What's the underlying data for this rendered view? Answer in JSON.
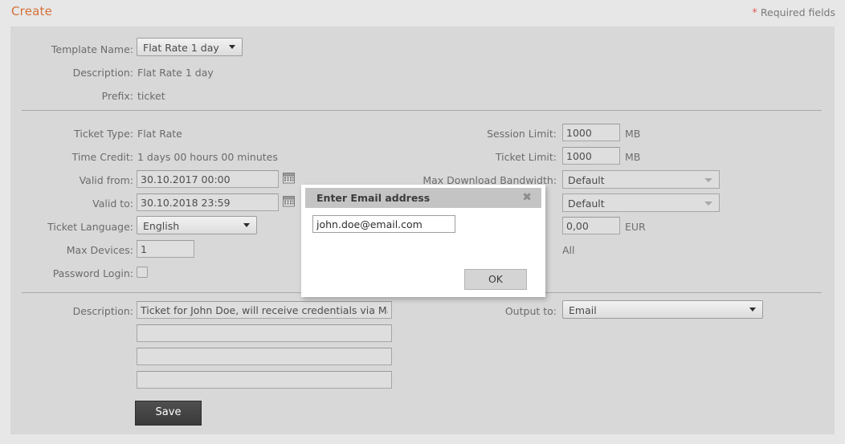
{
  "header": {
    "title": "Create",
    "required_star": "*",
    "required_label": "Required fields"
  },
  "template_section": {
    "template_name_label": "Template Name:",
    "template_name_value": "Flat Rate 1 day",
    "description_label": "Description:",
    "description_value": "Flat Rate 1 day",
    "prefix_label": "Prefix:",
    "prefix_value": "ticket"
  },
  "ticket_section": {
    "ticket_type_label": "Ticket Type:",
    "ticket_type_value": "Flat Rate",
    "time_credit_label": "Time Credit:",
    "time_credit_value": "1 days 00 hours 00 minutes",
    "valid_from_label": "Valid from:",
    "valid_from_value": "30.10.2017 00:00",
    "valid_to_label": "Valid to:",
    "valid_to_value": "30.10.2018 23:59",
    "ticket_language_label": "Ticket Language:",
    "ticket_language_value": "English",
    "max_devices_label": "Max Devices:",
    "max_devices_value": "1",
    "password_login_label": "Password Login:",
    "session_limit_label": "Session Limit:",
    "session_limit_value": "1000",
    "session_limit_unit": "MB",
    "ticket_limit_label": "Ticket Limit:",
    "ticket_limit_value": "1000",
    "ticket_limit_unit": "MB",
    "max_download_bandwidth_label": "Max Download Bandwidth:",
    "max_download_bandwidth_value": "Default",
    "max_upload_bandwidth_value": "Default",
    "price_value": "0,00",
    "price_unit": "EUR",
    "access_value": "All"
  },
  "description_section": {
    "description_label": "Description:",
    "description_line1": "Ticket for John Doe, will receive credentials via Mail",
    "description_line2": "",
    "description_line3": "",
    "description_line4": "",
    "output_to_label": "Output to:",
    "output_to_value": "Email",
    "save_label": "Save"
  },
  "modal": {
    "title": "Enter Email address",
    "close_glyph": "✖",
    "email_value": "john.doe@email.com",
    "ok_label": "OK"
  },
  "colors": {
    "accent": "#d4703a",
    "required_star": "#e05b5b",
    "panel_bg": "#d8d8d8",
    "page_bg": "#e7e7e7",
    "save_button": "#3f3f3f"
  }
}
